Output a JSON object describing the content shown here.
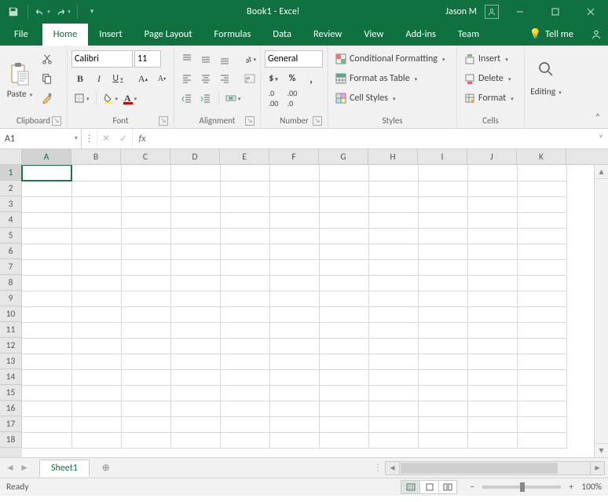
{
  "title": "Book1  -  Excel",
  "user": "Jason M",
  "tabs": [
    "File",
    "Home",
    "Insert",
    "Page Layout",
    "Formulas",
    "Data",
    "Review",
    "View",
    "Add-ins",
    "Team"
  ],
  "active_tab": "Home",
  "tellme": "Tell me",
  "ribbon": {
    "clipboard": {
      "label": "Clipboard",
      "paste": "Paste"
    },
    "font": {
      "label": "Font",
      "name": "Calibri",
      "size": "11",
      "bold": "B",
      "italic": "I",
      "underline": "U"
    },
    "alignment": {
      "label": "Alignment"
    },
    "number": {
      "label": "Number",
      "format": "General"
    },
    "styles": {
      "label": "Styles",
      "cond": "Conditional Formatting",
      "table": "Format as Table",
      "cell": "Cell Styles"
    },
    "cells": {
      "label": "Cells",
      "insert": "Insert",
      "delete": "Delete",
      "format": "Format"
    },
    "editing": {
      "label": "Editing"
    }
  },
  "namebox": "A1",
  "formula": "",
  "fx": "fx",
  "columns": [
    "A",
    "B",
    "C",
    "D",
    "E",
    "F",
    "G",
    "H",
    "I",
    "J",
    "K"
  ],
  "rows": [
    "1",
    "2",
    "3",
    "4",
    "5",
    "6",
    "7",
    "8",
    "9",
    "10",
    "11",
    "12",
    "13",
    "14",
    "15",
    "16",
    "17",
    "18"
  ],
  "selected": {
    "col": "A",
    "row": "1"
  },
  "sheet": "Sheet1",
  "status": "Ready",
  "zoom": "100%"
}
